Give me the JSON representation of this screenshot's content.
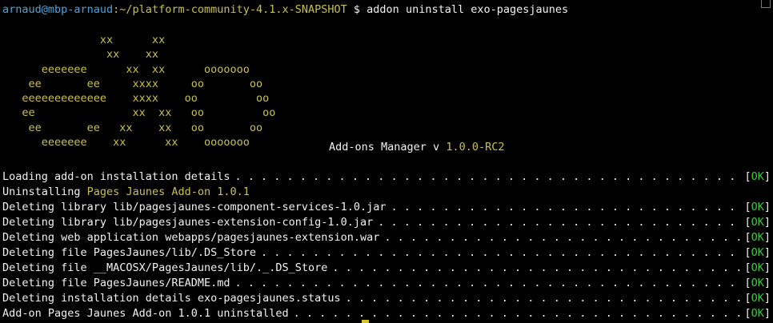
{
  "prompt": {
    "user_host": "arnaud@mbp-arnaud",
    "path": ":~/platform-community-4.1.x-SNAPSHOT",
    "symbol": " $ ",
    "command": "addon uninstall exo-pagesjaunes"
  },
  "logo": {
    "lines": [
      "               xx      xx",
      "                xx    xx",
      "      eeeeeee      xx  xx      ooooooo",
      "    ee       ee     xxxx     oo       oo",
      "   eeeeeeeeeeeee    xxxx    oo         oo",
      "   ee               xx  xx   oo         oo",
      "    ee       ee   xx    xx   oo       oo",
      "      eeeeeee    xx      xx    ooooooo"
    ]
  },
  "title": {
    "text": "Add-ons Manager v ",
    "version": "1.0.0-RC2"
  },
  "log": [
    {
      "prefix": "Loading add-on installation details",
      "highlight": "",
      "suffix": "",
      "dots": true,
      "status": "OK"
    },
    {
      "prefix": "Uninstalling ",
      "highlight": "Pages Jaunes Add-on 1.0.1",
      "suffix": "",
      "dots": false,
      "status": ""
    },
    {
      "prefix": "Deleting library lib/pagesjaunes-component-services-1.0.jar",
      "highlight": "",
      "suffix": "",
      "dots": true,
      "status": "OK"
    },
    {
      "prefix": "Deleting library lib/pagesjaunes-extension-config-1.0.jar",
      "highlight": "",
      "suffix": "",
      "dots": true,
      "status": "OK"
    },
    {
      "prefix": "Deleting web application webapps/pagesjaunes-extension.war",
      "highlight": "",
      "suffix": "",
      "dots": true,
      "status": "OK"
    },
    {
      "prefix": "Deleting file PagesJaunes/lib/.DS_Store",
      "highlight": "",
      "suffix": "",
      "dots": true,
      "status": "OK"
    },
    {
      "prefix": "Deleting file __MACOSX/PagesJaunes/lib/._.DS_Store",
      "highlight": "",
      "suffix": "",
      "dots": true,
      "status": "OK"
    },
    {
      "prefix": "Deleting file PagesJaunes/README.md",
      "highlight": "",
      "suffix": "",
      "dots": true,
      "status": "OK"
    },
    {
      "prefix": "Deleting installation details exo-pagesjaunes.status",
      "highlight": "",
      "suffix": "",
      "dots": true,
      "status": "OK"
    },
    {
      "prefix": "Add-on Pages Jaunes Add-on 1.0.1 uninstalled",
      "highlight": "",
      "suffix": "",
      "dots": true,
      "status": "OK"
    }
  ],
  "colors": {
    "background": "#000000",
    "text": "#f2f2f2",
    "user": "#4aa3df",
    "path": "#c8c050",
    "ok": "#3ec63e",
    "cursor": "#d4c22a"
  }
}
